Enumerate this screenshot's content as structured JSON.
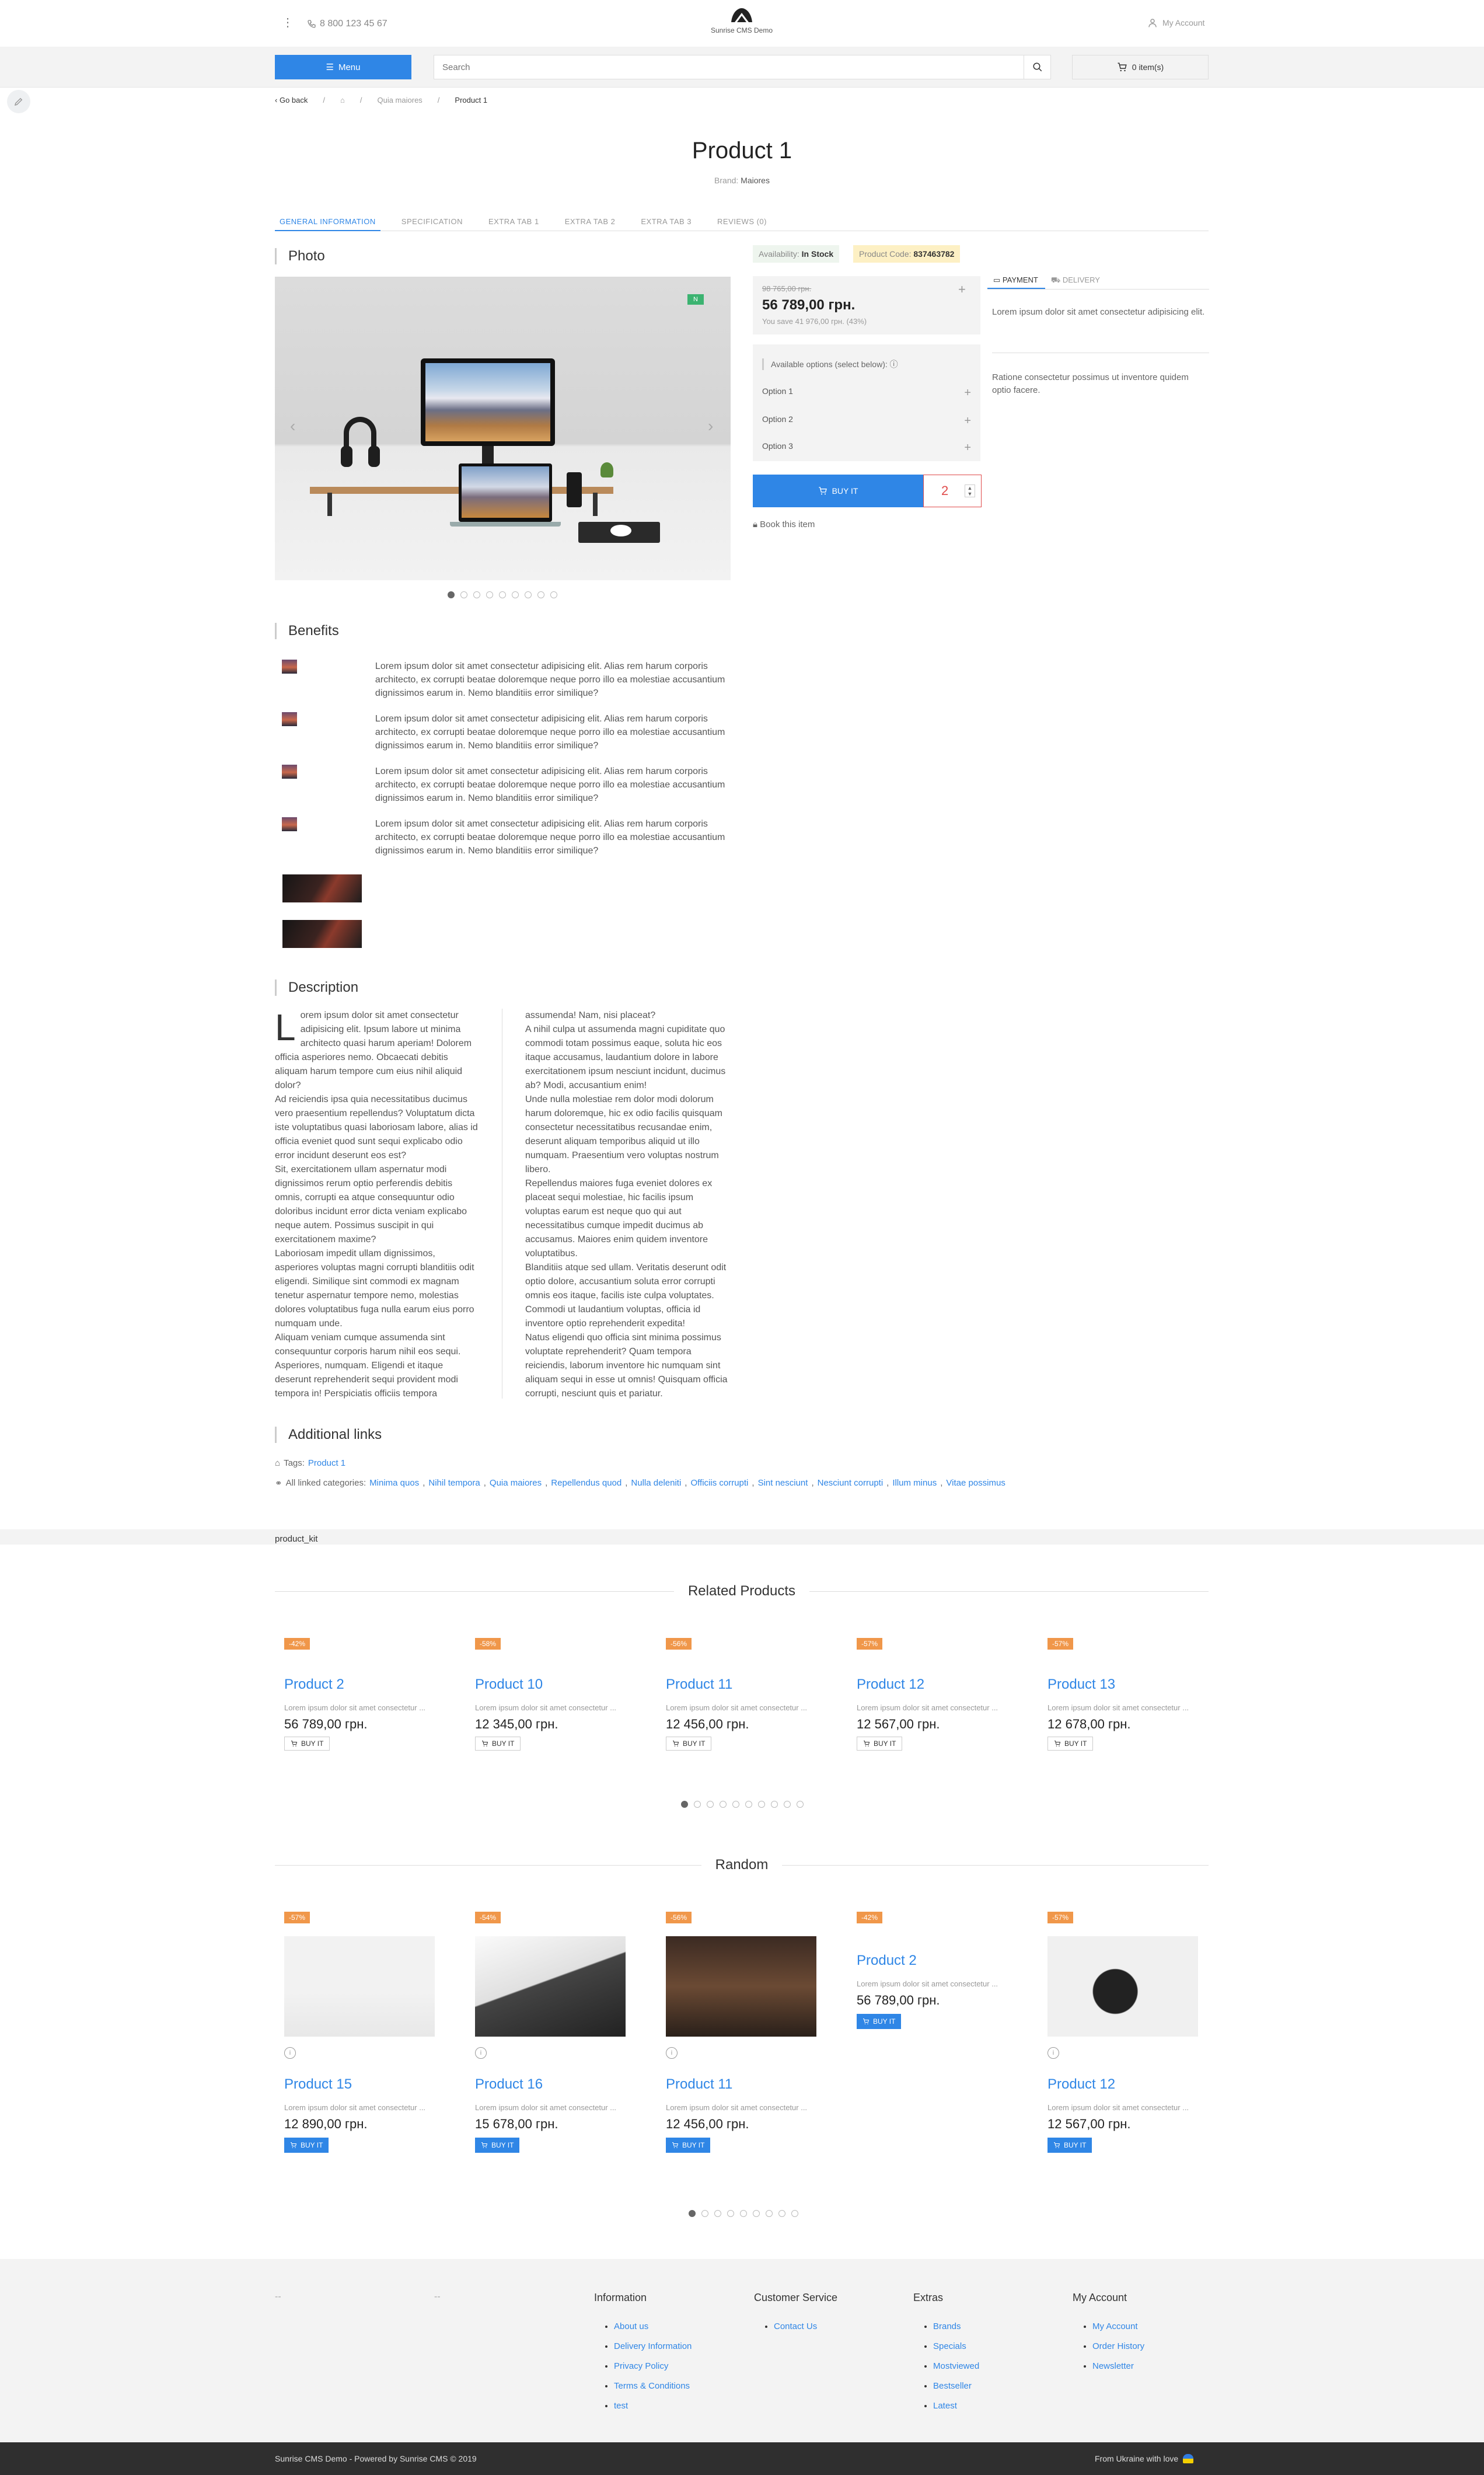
{
  "header": {
    "phone": "8 800 123 45 67",
    "logo_caption": "Sunrise CMS Demo",
    "account": "My Account"
  },
  "nav": {
    "menu_label": "Menu",
    "search_placeholder": "Search",
    "cart_label": "0 item(s)"
  },
  "breadcrumb": {
    "back": "Go back",
    "sep": "/",
    "category": "Quia maiores",
    "current": "Product 1"
  },
  "product": {
    "title": "Product 1",
    "brand_label": "Brand:",
    "brand_value": "Maiores",
    "tabs": [
      "GENERAL INFORMATION",
      "SPECIFICATION",
      "EXTRA TAB 1",
      "EXTRA TAB 2",
      "EXTRA TAB 3",
      "REVIEWS (0)"
    ],
    "photo_title": "Photo",
    "photo_badge": "N",
    "availability_label": "Availability:",
    "availability_value": "In Stock",
    "code_label": "Product Code:",
    "code_value": "837463782",
    "old_price": "98 765,00 грн.",
    "price": "56 789,00 грн.",
    "save_text": "You save 41 976,00 грн. (43%)",
    "options_title": "Available options (select below):",
    "options": [
      "Option 1",
      "Option 2",
      "Option 3"
    ],
    "buy_label": "BUY IT",
    "qty": "2",
    "book_label": "Book this item",
    "info_tabs": [
      "PAYMENT",
      "DELIVERY"
    ],
    "payment_text": "Lorem ipsum dolor sit amet consectetur adipisicing elit.",
    "payment_text2": "Ratione consectetur possimus ut inventore quidem optio facere."
  },
  "benefits": {
    "title": "Benefits",
    "text": "Lorem ipsum dolor sit amet consectetur adipisicing elit. Alias rem harum corporis architecto, ex corrupti beatae doloremque neque porro illo ea molestiae accusantium dignissimos earum in. Nemo blanditiis error similique?"
  },
  "description": {
    "title": "Description",
    "dropcap": "L",
    "col1": "orem ipsum dolor sit amet consectetur adipisicing elit. Ipsum labore ut minima architecto quasi harum aperiam! Dolorem officia asperiores nemo. Obcaecati debitis aliquam harum tempore cum eius nihil aliquid dolor?\nAd reiciendis ipsa quia necessitatibus ducimus vero praesentium repellendus? Voluptatum dicta iste voluptatibus quasi laboriosam labore, alias id officia eveniet quod sunt sequi explicabo odio error incidunt deserunt eos est?\nSit, exercitationem ullam aspernatur modi dignissimos rerum optio perferendis debitis omnis, corrupti ea atque consequuntur odio doloribus incidunt error dicta veniam explicabo neque autem. Possimus suscipit in qui exercitationem maxime?\nLaboriosam impedit ullam dignissimos, asperiores voluptas magni corrupti blanditiis odit eligendi. Similique sint commodi ex magnam tenetur aspernatur tempore nemo, molestias dolores voluptatibus fuga nulla earum eius porro numquam unde.\nAliquam veniam cumque assumenda sint consequuntur corporis harum nihil eos sequi. Asperiores, numquam. Eligendi et itaque deserunt reprehenderit sequi provident modi tempora in! Perspiciatis officiis tempora",
    "col2": "assumenda! Nam, nisi placeat?\nA nihil culpa ut assumenda magni cupiditate quo commodi totam possimus eaque, soluta hic eos itaque accusamus, laudantium dolore in labore exercitationem ipsum nesciunt incidunt, ducimus ab? Modi, accusantium enim!\nUnde nulla molestiae rem dolor modi dolorum harum doloremque, hic ex odio facilis quisquam consectetur necessitatibus recusandae enim, deserunt aliquam temporibus aliquid ut illo numquam. Praesentium vero voluptas nostrum libero.\nRepellendus maiores fuga eveniet dolores ex placeat sequi molestiae, hic facilis ipsum voluptas earum est neque quo qui aut necessitatibus cumque impedit ducimus ab accusamus. Maiores enim quidem inventore voluptatibus.\nBlanditiis atque sed ullam. Veritatis deserunt odit optio dolore, accusantium soluta error corrupti omnis eos itaque, facilis iste culpa voluptates. Commodi ut laudantium voluptas, officia id inventore optio reprehenderit expedita!\nNatus eligendi quo officia sint minima possimus voluptate reprehenderit? Quam tempora reiciendis, laborum inventore hic numquam sint aliquam sequi in esse ut omnis! Quisquam officia corrupti, nesciunt quis et pariatur."
  },
  "links": {
    "title": "Additional links",
    "tags_label": "Tags:",
    "tag": "Product 1",
    "categories_label": "All linked categories:",
    "categories": [
      "Minima quos",
      "Nihil tempora",
      "Quia maiores",
      "Repellendus quod",
      "Nulla deleniti",
      "Officiis corrupti",
      "Sint nesciunt",
      "Nesciunt corrupti",
      "Illum minus",
      "Vitae possimus"
    ]
  },
  "kit_label": "product_kit",
  "related": {
    "title": "Related Products",
    "desc": "Lorem ipsum dolor sit amet consectetur ...",
    "buy": "BUY IT",
    "items": [
      {
        "sale": "-42%",
        "name": "Product 2",
        "price": "56 789,00 грн."
      },
      {
        "sale": "-58%",
        "name": "Product 10",
        "price": "12 345,00 грн."
      },
      {
        "sale": "-56%",
        "name": "Product 11",
        "price": "12 456,00 грн."
      },
      {
        "sale": "-57%",
        "name": "Product 12",
        "price": "12 567,00 грн."
      },
      {
        "sale": "-57%",
        "name": "Product 13",
        "price": "12 678,00 грн."
      }
    ]
  },
  "random": {
    "title": "Random",
    "desc": "Lorem ipsum dolor sit amet consectetur ...",
    "buy": "BUY IT",
    "items": [
      {
        "sale": "-57%",
        "name": "Product 15",
        "price": "12 890,00 грн."
      },
      {
        "sale": "-54%",
        "name": "Product 16",
        "price": "15 678,00 грн."
      },
      {
        "sale": "-56%",
        "name": "Product 11",
        "price": "12 456,00 грн."
      },
      {
        "sale": "-42%",
        "name": "Product 2",
        "price": "56 789,00 грн."
      },
      {
        "sale": "-57%",
        "name": "Product 12",
        "price": "12 567,00 грн."
      }
    ]
  },
  "footer": {
    "dash": "--",
    "information": {
      "title": "Information",
      "items": [
        "About us",
        "Delivery Information",
        "Privacy Policy",
        "Terms & Conditions",
        "test"
      ]
    },
    "service": {
      "title": "Customer Service",
      "items": [
        "Contact Us"
      ]
    },
    "extras": {
      "title": "Extras",
      "items": [
        "Brands",
        "Specials",
        "Mostviewed",
        "Bestseller",
        "Latest"
      ]
    },
    "account": {
      "title": "My Account",
      "items": [
        "My Account",
        "Order History",
        "Newsletter"
      ]
    },
    "copyright": "Sunrise CMS Demo - Powered by Sunrise CMS © 2019",
    "love": "From Ukraine with love"
  }
}
